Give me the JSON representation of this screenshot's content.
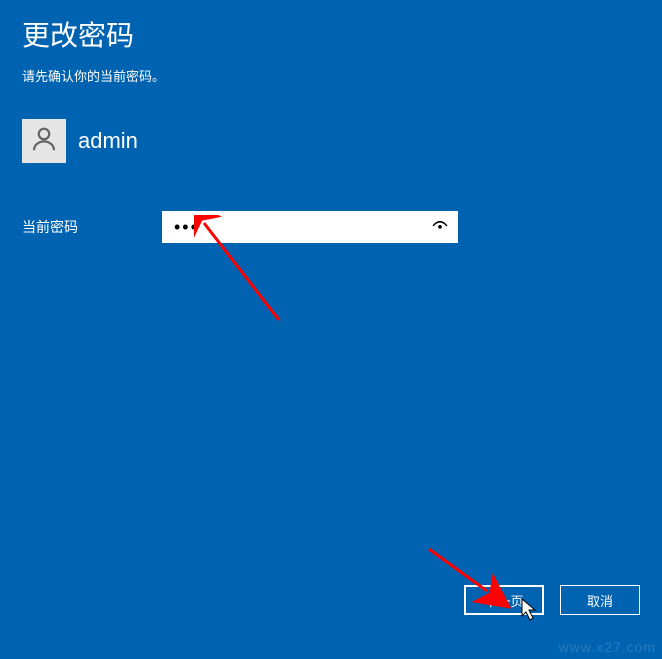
{
  "title": "更改密码",
  "subtitle": "请先确认你的当前密码。",
  "user": {
    "name": "admin"
  },
  "field": {
    "label": "当前密码",
    "value": "•••"
  },
  "buttons": {
    "next": "下一页",
    "cancel": "取消"
  },
  "watermark": "www.x27.com"
}
